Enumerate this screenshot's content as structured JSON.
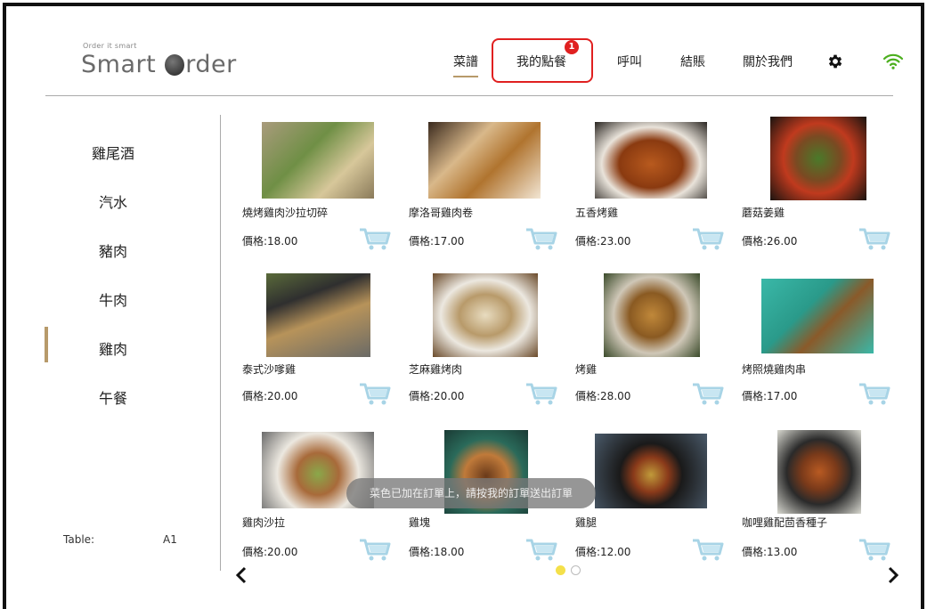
{
  "app": {
    "logo_tagline": "Order it smart",
    "logo_part1": "Smart ",
    "logo_part2": "rder"
  },
  "nav": {
    "menu": "菜譜",
    "my_order": "我的點餐",
    "order_badge": "1",
    "call": "呼叫",
    "checkout": "結賬",
    "about": "關於我們",
    "settings_icon": "gear-icon",
    "wifi_icon": "wifi-icon"
  },
  "colors": {
    "accent": "#b79a6a",
    "alert": "#e02020",
    "cart": "#a8d4e6"
  },
  "sidebar": {
    "items": [
      {
        "label": "雞尾酒"
      },
      {
        "label": "汽水"
      },
      {
        "label": "豬肉"
      },
      {
        "label": "牛肉"
      },
      {
        "label": "雞肉",
        "active": true
      },
      {
        "label": "午餐"
      }
    ],
    "table_label": "Table:",
    "table_value": "A1"
  },
  "items": [
    {
      "title": "燒烤雞肉沙拉切碎",
      "price": "價格:18.00"
    },
    {
      "title": "摩洛哥雞肉卷",
      "price": "價格:17.00"
    },
    {
      "title": "五香烤雞",
      "price": "價格:23.00"
    },
    {
      "title": "蘑菇姜雞",
      "price": "價格:26.00"
    },
    {
      "title": "泰式沙嗲雞",
      "price": "價格:20.00"
    },
    {
      "title": "芝麻雞烤肉",
      "price": "價格:20.00"
    },
    {
      "title": "烤雞",
      "price": "價格:28.00"
    },
    {
      "title": "烤照燒雞肉串",
      "price": "價格:17.00"
    },
    {
      "title": "雞肉沙拉",
      "price": "價格:20.00"
    },
    {
      "title": "雞塊",
      "price": "價格:18.00"
    },
    {
      "title": "雞腿",
      "price": "價格:12.00"
    },
    {
      "title": "咖哩雞配茴香種子",
      "price": "價格:13.00"
    }
  ],
  "toast": "菜色已加在訂單上，請按我的訂單送出訂單",
  "pagination": {
    "current": 1,
    "total": 2
  }
}
